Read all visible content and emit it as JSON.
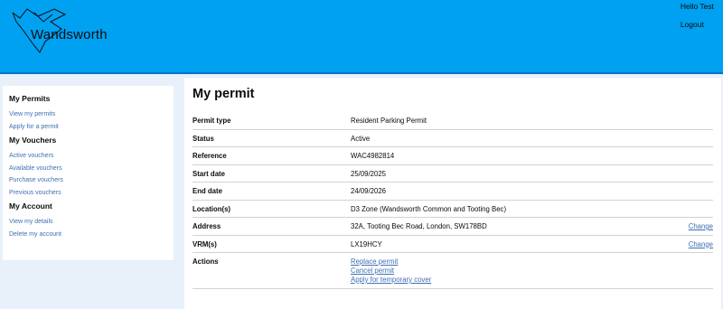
{
  "header": {
    "logo_text": "Wandsworth",
    "greeting": "Hello Test",
    "logout_label": "Logout"
  },
  "sidebar": {
    "groups": [
      {
        "heading": "My Permits",
        "links": [
          "View my permits",
          "Apply for a permit"
        ]
      },
      {
        "heading": "My Vouchers",
        "links": [
          "Active vouchers",
          "Available vouchers",
          "Purchase vouchers",
          "Previous vouchers"
        ]
      },
      {
        "heading": "My Account",
        "links": [
          "View my details",
          "Delete my account"
        ]
      }
    ]
  },
  "main": {
    "title": "My permit",
    "rows": [
      {
        "key": "Permit type",
        "value": "Resident Parking Permit",
        "action": ""
      },
      {
        "key": "Status",
        "value": "Active",
        "action": ""
      },
      {
        "key": "Reference",
        "value": "WAC4982814",
        "action": ""
      },
      {
        "key": "Start date",
        "value": "25/09/2025",
        "action": ""
      },
      {
        "key": "End date",
        "value": "24/09/2026",
        "action": ""
      },
      {
        "key": "Location(s)",
        "value": "D3 Zone (Wandsworth Common and Tooting Bec)",
        "action": ""
      },
      {
        "key": "Address",
        "value": "32A, Tooting Bec Road, London, SW178BD",
        "action": "Change"
      },
      {
        "key": "VRM(s)",
        "value": "LX19HCY",
        "action": "Change"
      }
    ],
    "actions_key": "Actions",
    "actions": [
      "Replace permit",
      "Cancel permit",
      "Apply for temporary cover"
    ]
  },
  "colors": {
    "header_bg": "#00a1f1",
    "page_bg": "#e8f0f9",
    "link": "#3f6fb5"
  }
}
